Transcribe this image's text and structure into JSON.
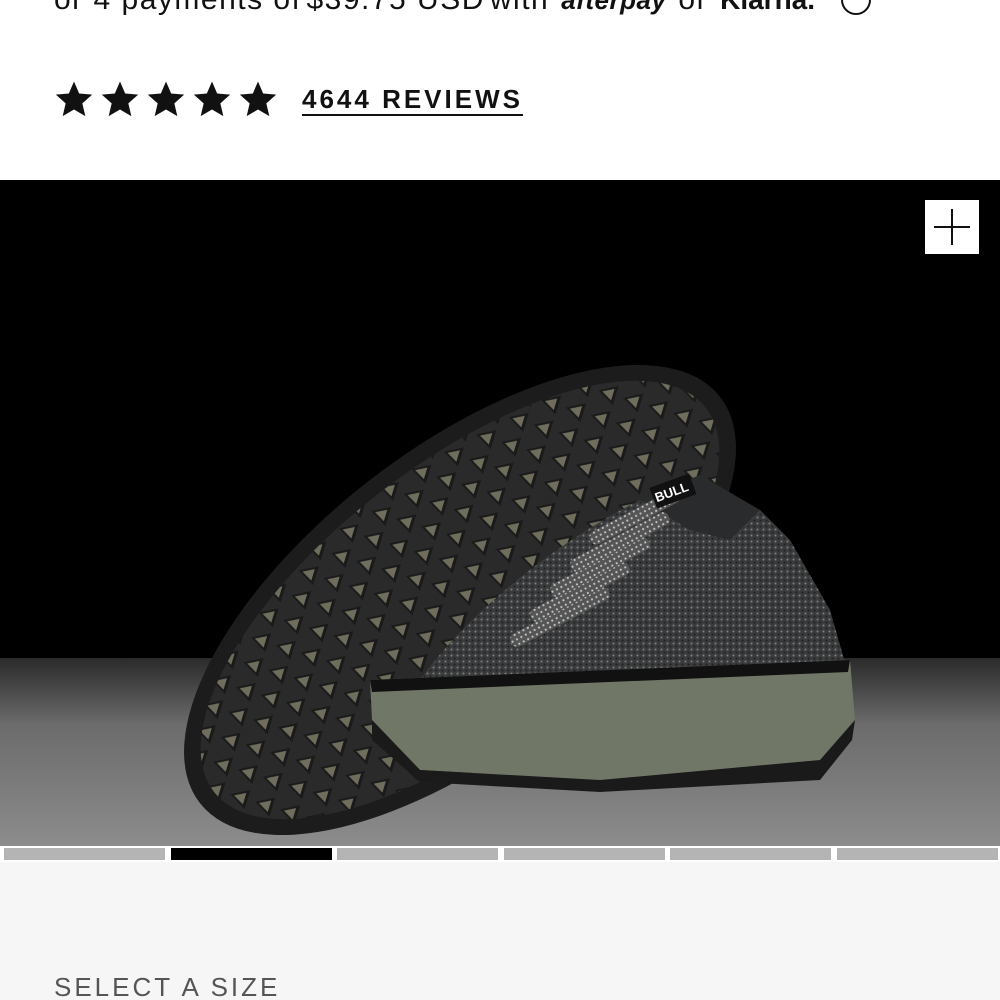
{
  "payment": {
    "prefix": "or 4 payments of",
    "amount": "$39.75 USD",
    "with_text": "with",
    "afterpay_label": "afterpay",
    "or_text": "or",
    "klarna_label": "Klarna."
  },
  "rating": {
    "stars": 5,
    "reviews_label": "4644 REVIEWS"
  },
  "product_image": {
    "alt": "product image",
    "zoom_icon": "plus-icon",
    "brand_tag": "BULL"
  },
  "carousel": {
    "count": 6,
    "active_index": 1
  },
  "size_selector": {
    "label": "SELECT A SIZE"
  },
  "colors": {
    "accent": "#111111",
    "indicator_inactive": "#b4b4b4",
    "indicator_active": "#000000",
    "size_area_bg": "#f6f6f6"
  }
}
